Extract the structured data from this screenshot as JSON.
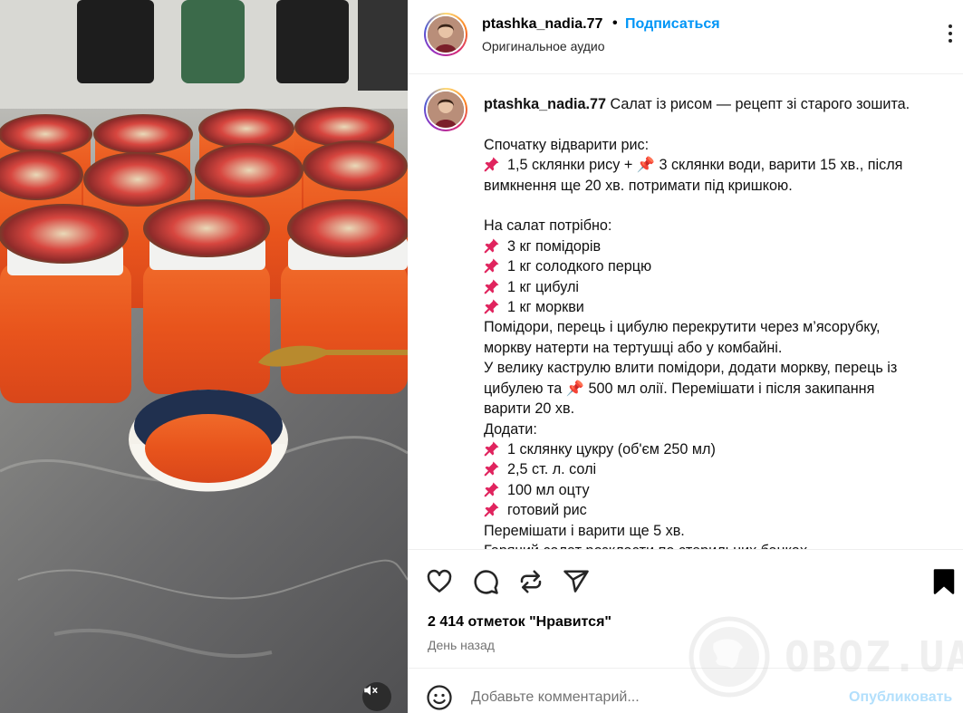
{
  "post": {
    "username": "ptashka_nadia.77",
    "separator": "•",
    "follow_label": "Подписаться",
    "audio_label": "Оригинальное аудио",
    "more_icon": "more-vertical-icon"
  },
  "caption": {
    "username": "ptashka_nadia.77",
    "lines": [
      {
        "text": "Салат із рисом — рецепт зі старого зошита.",
        "pin": false,
        "first": true
      },
      {
        "text": "",
        "pin": false
      },
      {
        "text": "Спочатку відварити рис:",
        "pin": false
      },
      {
        "text": "1,5 склянки рису + 📌 3 склянки води, варити 15 хв., після",
        "pin": true
      },
      {
        "text": "вимкнення ще 20 хв. потримати під кришкою.",
        "pin": false
      },
      {
        "text": "",
        "pin": false
      },
      {
        "text": "На салат потрібно:",
        "pin": false
      },
      {
        "text": "3 кг помідорів",
        "pin": true
      },
      {
        "text": "1 кг солодкого перцю",
        "pin": true
      },
      {
        "text": "1 кг цибулі",
        "pin": true
      },
      {
        "text": "1 кг моркви",
        "pin": true
      },
      {
        "text": "Помідори, перець і цибулю перекрутити через м’ясорубку,",
        "pin": false
      },
      {
        "text": "моркву натерти на тертушці або у комбайні.",
        "pin": false
      },
      {
        "text": "У велику каструлю влити помідори, додати моркву, перець із",
        "pin": false
      },
      {
        "text": "цибулею та 📌 500 мл олії. Перемішати і після закипання",
        "pin": false
      },
      {
        "text": "варити 20 хв.",
        "pin": false
      },
      {
        "text": "Додати:",
        "pin": false
      },
      {
        "text": "1 склянку цукру (об'єм 250 мл)",
        "pin": true
      },
      {
        "text": "2,5 ст. л. солі",
        "pin": true
      },
      {
        "text": "100 мл оцту",
        "pin": true
      },
      {
        "text": "готовий рис",
        "pin": true
      },
      {
        "text": "Перемішати і варити ще 5 хв.",
        "pin": false
      },
      {
        "text": "Гарячий салат розкласти по стерильних банках",
        "pin": false
      }
    ]
  },
  "actions": {
    "icons": [
      "heart-icon",
      "comment-icon",
      "repost-icon",
      "share-icon",
      "bookmark-icon"
    ],
    "likes_text": "2 414 отметок \"Нравится\"",
    "date_text": "День назад"
  },
  "watermark": {
    "text": "OBOZ.UA"
  },
  "comment": {
    "placeholder": "Добавьте комментарий...",
    "publish_label": "Опубликовать",
    "emoji_icon": "emoji-icon"
  },
  "media": {
    "mute_icon": "speaker-muted-icon"
  },
  "colors": {
    "link": "#0095f6",
    "publish_disabled": "#b2dffc",
    "salad": "#e8541c",
    "lid_red": "#c2203a"
  }
}
